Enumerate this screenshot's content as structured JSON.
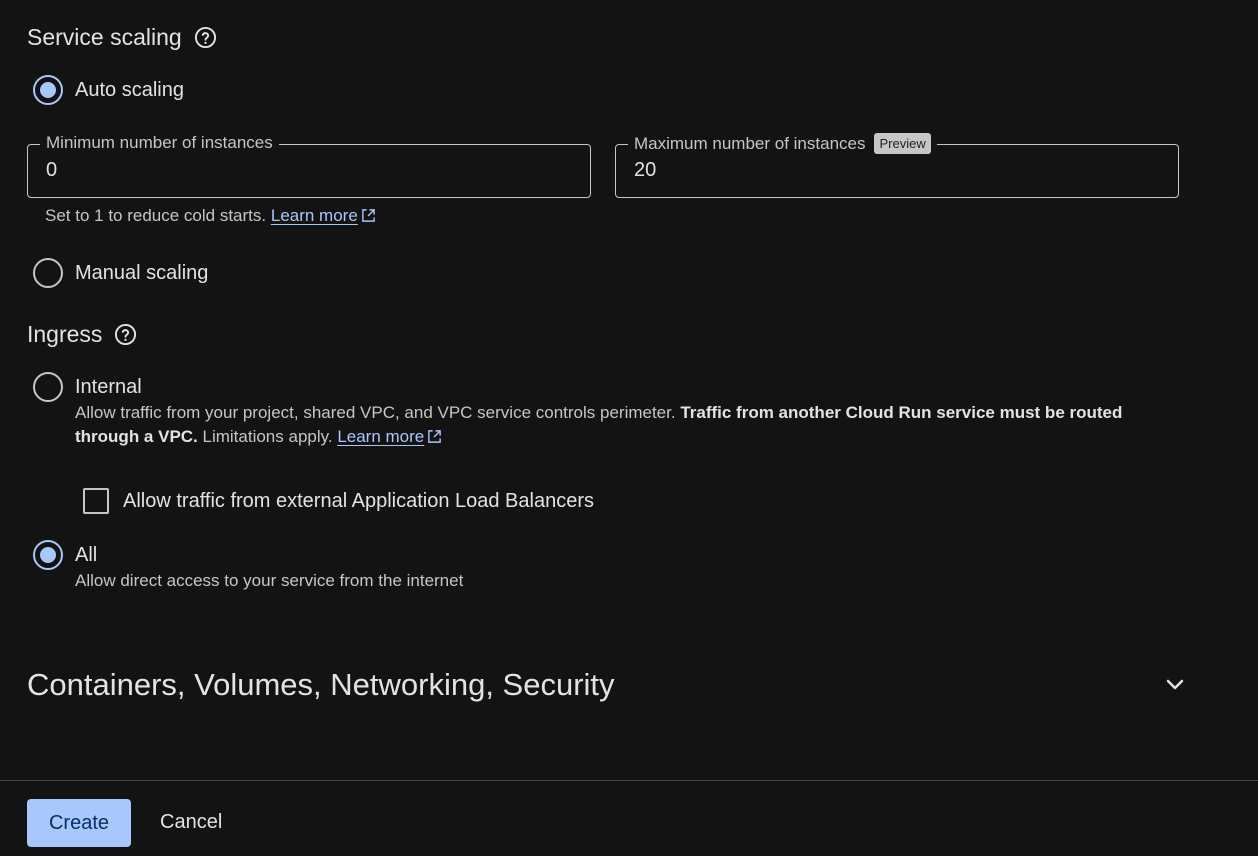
{
  "service_scaling": {
    "title": "Service scaling",
    "auto_scaling": {
      "label": "Auto scaling",
      "selected": true
    },
    "min_instances": {
      "label": "Minimum number of instances",
      "value": "0"
    },
    "max_instances": {
      "label": "Maximum number of instances",
      "badge": "Preview",
      "value": "20"
    },
    "helper_text": "Set to 1 to reduce cold starts.",
    "learn_more": "Learn more",
    "manual_scaling": {
      "label": "Manual scaling",
      "selected": false
    }
  },
  "ingress": {
    "title": "Ingress",
    "internal": {
      "label": "Internal",
      "selected": false,
      "desc_plain": "Allow traffic from your project, shared VPC, and VPC service controls perimeter. ",
      "desc_bold": "Traffic from another Cloud Run service must be routed through a VPC.",
      "desc_tail": " Limitations apply. ",
      "learn_more": "Learn more"
    },
    "allow_alb": {
      "label": "Allow traffic from external Application Load Balancers",
      "checked": false
    },
    "all": {
      "label": "All",
      "selected": true,
      "desc": "Allow direct access to your service from the internet"
    }
  },
  "collapsible": {
    "title": "Containers, Volumes, Networking, Security"
  },
  "footer": {
    "create_label": "Create",
    "cancel_label": "Cancel"
  },
  "colors": {
    "accent": "#a8c7fa",
    "background": "#131314",
    "text": "#e3e3e3"
  }
}
